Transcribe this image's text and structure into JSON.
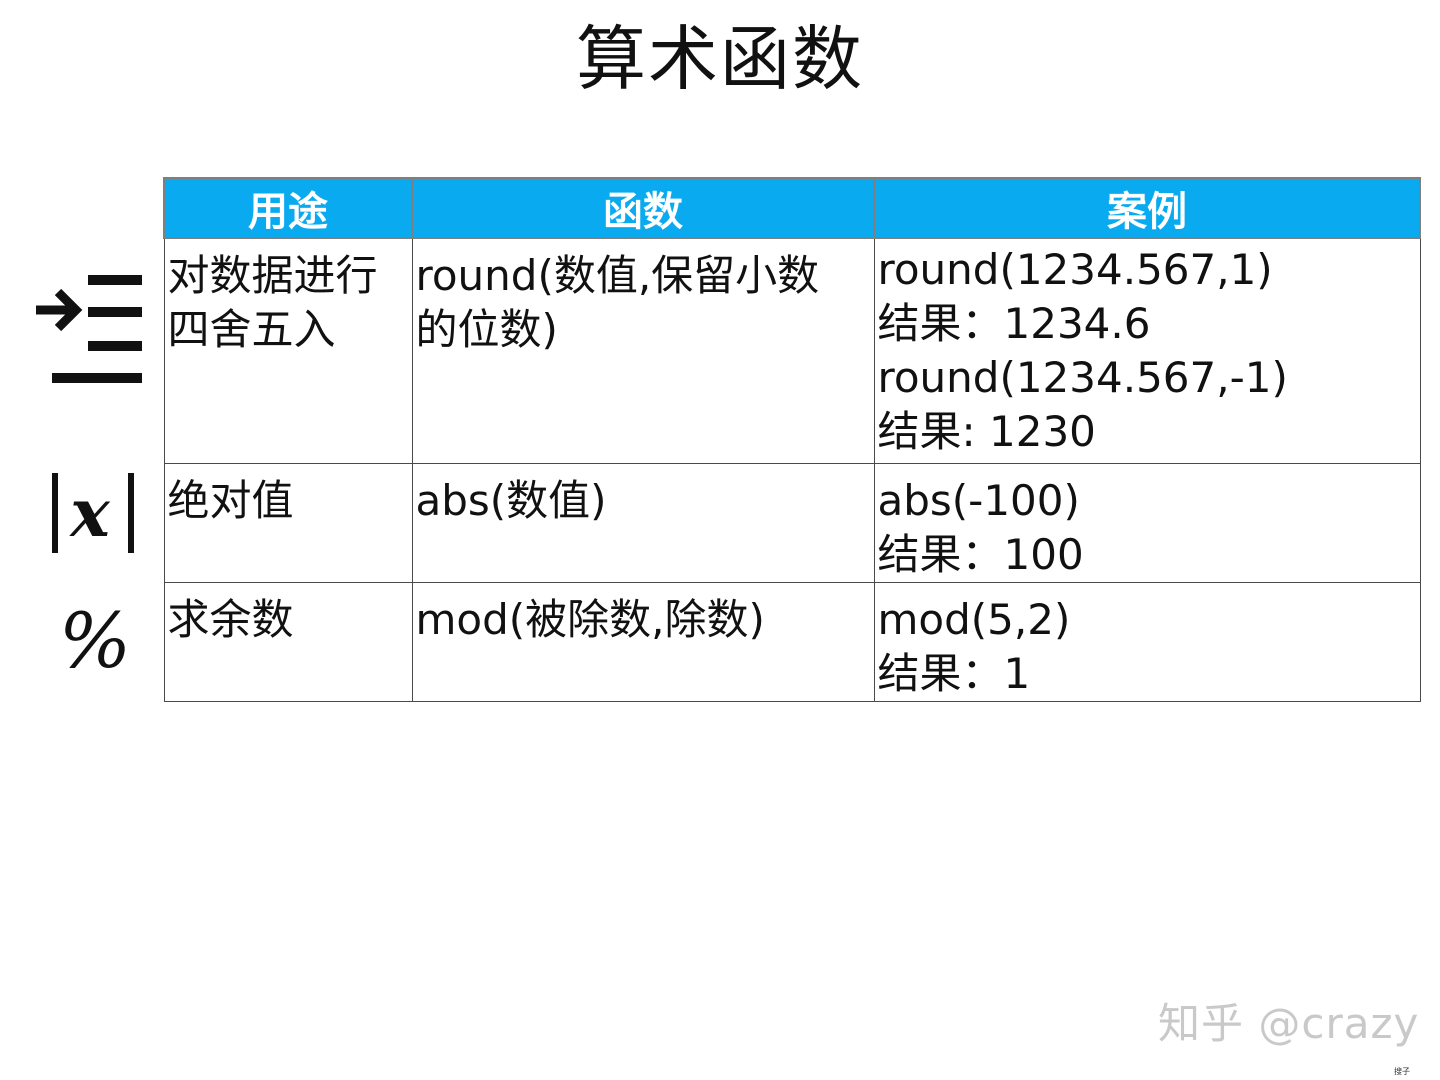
{
  "title": "算术函数",
  "table": {
    "headers": [
      "用途",
      "函数",
      "案例"
    ],
    "rows": [
      {
        "icon": "round-arrow-icon",
        "purpose_lines": [
          "对数据进行",
          "四舍五入"
        ],
        "function_lines": [
          "round(数值,保留小数",
          "的位数)"
        ],
        "example_lines": [
          "round(1234.567,1)",
          "结果：1234.6",
          "round(1234.567,-1)",
          "结果: 1230"
        ]
      },
      {
        "icon": "absolute-value-icon",
        "purpose_lines": [
          "绝对值"
        ],
        "function_lines": [
          "abs(数值)"
        ],
        "example_lines": [
          "abs(-100)",
          "结果：100"
        ]
      },
      {
        "icon": "percent-icon",
        "purpose_lines": [
          "求余数"
        ],
        "function_lines": [
          "mod(被除数,除数)"
        ],
        "example_lines": [
          "mod(5,2)",
          "结果：1"
        ]
      }
    ]
  },
  "icon_glyphs": {
    "abs": "x",
    "percent": "%"
  },
  "watermark": "知乎 @crazy",
  "corner_mark": "搜子",
  "colors": {
    "header_bg": "#0aaaf0",
    "header_text": "#ffffff",
    "border": "#4a4a4a"
  }
}
